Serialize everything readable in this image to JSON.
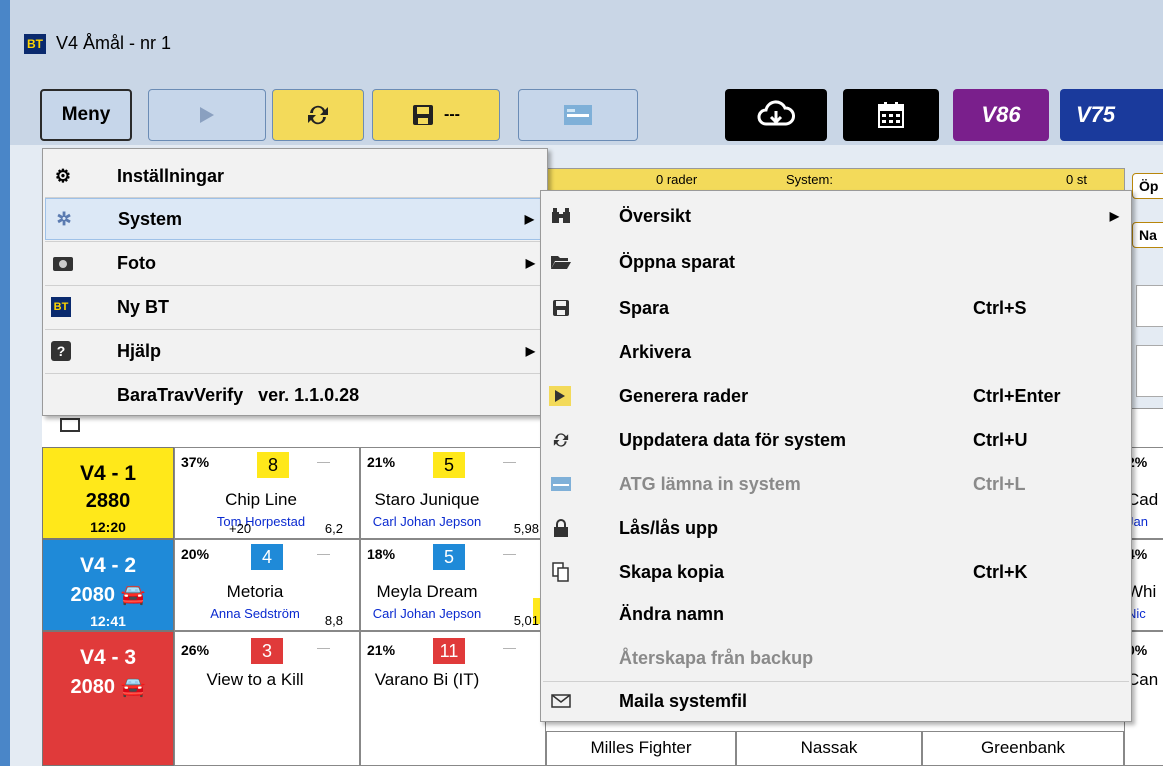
{
  "window": {
    "title": "V4 Åmål - nr 1",
    "logo": "BT"
  },
  "toolbar": {
    "meny_label": "Meny",
    "save_label": "---",
    "v86_label": "V86",
    "v75_label": "V75",
    "icons": [
      "play-icon",
      "sync-icon",
      "floppy-icon",
      "atg-icon",
      "cloud-download-icon",
      "calendar-icon"
    ]
  },
  "header_band": {
    "left_text": "0 rader",
    "mid_text": "System:",
    "right_text": "0 st"
  },
  "side_buttons": {
    "top": "Öp",
    "second": "Na"
  },
  "main_menu": {
    "items": [
      {
        "icon": "gear-icon",
        "label": "Inställningar",
        "submenu": false
      },
      {
        "icon": "system-icon",
        "label": "System",
        "submenu": true,
        "selected": true
      },
      {
        "icon": "camera-icon",
        "label": "Foto",
        "submenu": true
      },
      {
        "icon": "bt-icon",
        "label": "Ny BT",
        "submenu": false
      },
      {
        "icon": "help-icon",
        "label": "Hjälp",
        "submenu": true
      }
    ],
    "version": "BaraTravVerify   ver. 1.1.0.28"
  },
  "system_menu": {
    "items": [
      {
        "icon": "binoculars-icon",
        "label": "Översikt",
        "shortcut": "",
        "submenu": true
      },
      {
        "icon": "folder-open-icon",
        "label": "Öppna sparat",
        "shortcut": ""
      },
      {
        "icon": "floppy-icon",
        "label": "Spara",
        "shortcut": "Ctrl+S"
      },
      {
        "icon": "",
        "label": "Arkivera",
        "shortcut": ""
      },
      {
        "icon": "play-icon",
        "label": "Generera rader",
        "shortcut": "Ctrl+Enter"
      },
      {
        "icon": "sync-icon",
        "label": "Uppdatera data för system",
        "shortcut": "Ctrl+U"
      },
      {
        "icon": "atg-icon",
        "label": "ATG lämna in system",
        "shortcut": "Ctrl+L",
        "disabled": true
      },
      {
        "icon": "lock-icon",
        "label": "Lås/lås upp",
        "shortcut": ""
      },
      {
        "icon": "copy-icon",
        "label": "Skapa kopia",
        "shortcut": "Ctrl+K"
      },
      {
        "icon": "",
        "label": "Ändra namn",
        "shortcut": ""
      },
      {
        "icon": "",
        "label": "Återskapa från backup",
        "shortcut": "",
        "disabled": true
      },
      {
        "icon": "mail-icon",
        "label": "Maila systemfil",
        "shortcut": ""
      }
    ]
  },
  "races": [
    {
      "name": "V4 - 1",
      "distance": "2880",
      "car": "",
      "time": "12:20",
      "color": "#ffe81a"
    },
    {
      "name": "V4 - 2",
      "distance": "2080",
      "car": "car-icon",
      "time": "12:41",
      "color": "#1f8ad8"
    },
    {
      "name": "V4 - 3",
      "distance": "2080",
      "car": "car-icon",
      "time": "",
      "color": "#e03a3a"
    }
  ],
  "cells": [
    {
      "pct": "37%",
      "num": "8",
      "horse": "Chip Line",
      "driver": "Tom Horpestad",
      "extra": "+20",
      "odds": "6,2"
    },
    {
      "pct": "21%",
      "num": "5",
      "horse": "Staro Junique",
      "driver": "Carl Johan Jepson",
      "extra": "",
      "odds": "5,98"
    },
    {
      "pct": "2%",
      "num": "",
      "horse": "Cad",
      "driver": "Jan",
      "extra": "",
      "odds": ""
    },
    {
      "pct": "20%",
      "num": "4",
      "horse": "Metoria",
      "driver": "Anna Sedström",
      "extra": "",
      "odds": "8,8"
    },
    {
      "pct": "18%",
      "num": "5",
      "horse": "Meyla Dream",
      "driver": "Carl Johan Jepson",
      "extra": "",
      "odds": "5,01"
    },
    {
      "pct": "4%",
      "num": "",
      "horse": "Whi",
      "driver": "Nic",
      "extra": "",
      "odds": ""
    },
    {
      "pct": "26%",
      "num": "3",
      "horse": "View to a Kill",
      "driver": "",
      "extra": "",
      "odds": ""
    },
    {
      "pct": "21%",
      "num": "11",
      "horse": "Varano Bi (IT)",
      "driver": "",
      "extra": "",
      "odds": ""
    },
    {
      "pct": "",
      "num": "",
      "horse": "Milles Fighter",
      "driver": "",
      "extra": "",
      "odds": ""
    },
    {
      "pct": "",
      "num": "",
      "horse": "Nassak",
      "driver": "",
      "extra": "",
      "odds": ""
    },
    {
      "pct": "",
      "num": "",
      "horse": "Greenbank",
      "driver": "",
      "extra": "",
      "odds": ""
    },
    {
      "pct": "0%",
      "num": "",
      "horse": "Can",
      "driver": "",
      "extra": "",
      "odds": ""
    }
  ],
  "colors": {
    "accent": "#f3da5a",
    "blue": "#1f8ad8",
    "red": "#e03a3a",
    "driver": "#0a2ad0"
  }
}
